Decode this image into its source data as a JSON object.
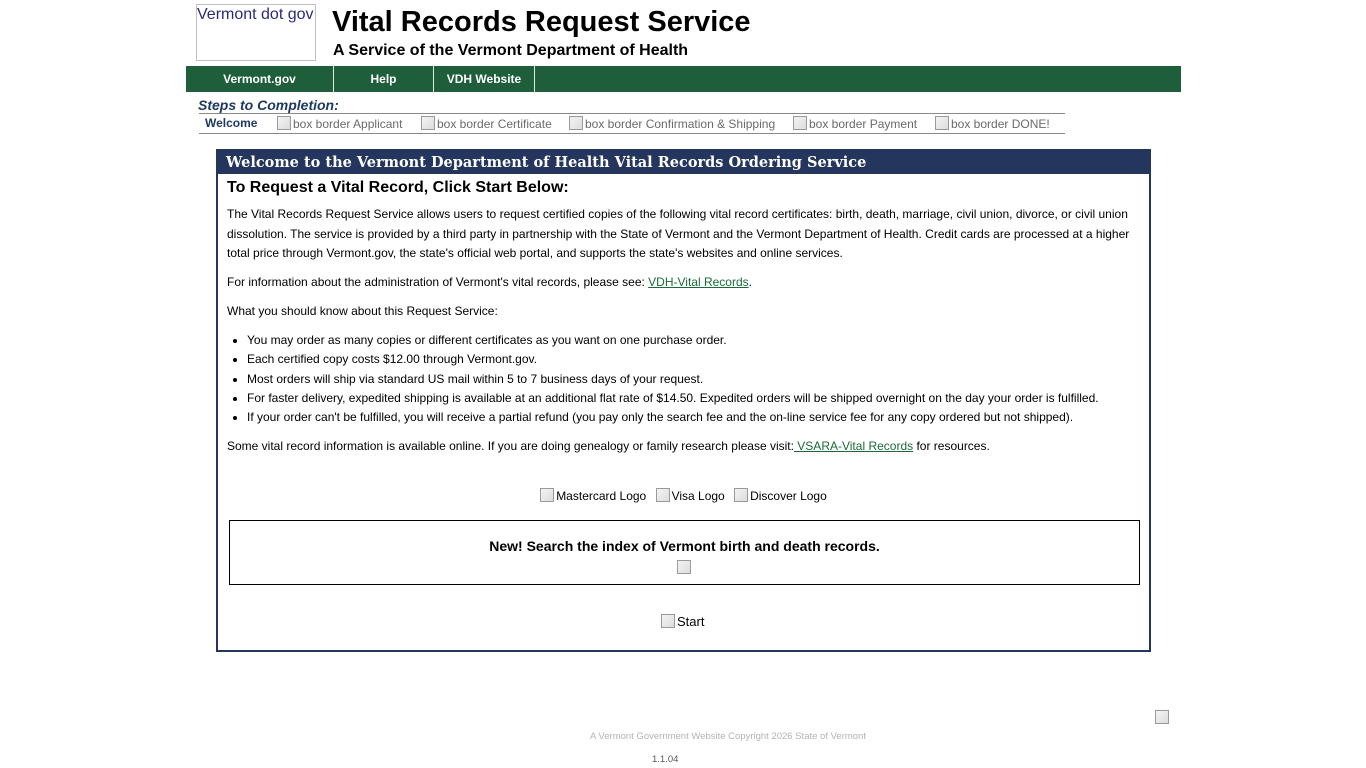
{
  "header": {
    "logo_alt": "Vermont dot gov",
    "title": "Vital Records Request Service",
    "subtitle": "A Service of the Vermont Department of Health"
  },
  "nav": {
    "items": [
      {
        "label": "Vermont.gov"
      },
      {
        "label": "Help"
      },
      {
        "label": "VDH Website"
      }
    ]
  },
  "steps": {
    "title": "Steps to Completion:",
    "image_alt": "box border",
    "items": [
      {
        "label": "Welcome",
        "active": true
      },
      {
        "label": "Applicant"
      },
      {
        "label": "Certificate"
      },
      {
        "label": "Confirmation & Shipping"
      },
      {
        "label": "Payment"
      },
      {
        "label": "DONE!"
      }
    ]
  },
  "panel": {
    "header": "Welcome to the Vermont Department of Health Vital Records Ordering Service",
    "heading": "To Request a Vital Record, Click Start Below:",
    "intro": "The Vital Records Request Service allows users to request certified copies of the following vital record certificates: birth, death, marriage, civil union, divorce, or civil union dissolution. The service is provided by a third party in partnership with the State of Vermont and the Vermont Department of Health. Credit cards are processed at a higher total price through Vermont.gov, the state's official web portal, and supports the state's websites and online services.",
    "admin_info_prefix": "For information about the administration of Vermont's vital records, please see: ",
    "admin_link": "VDH-Vital Records",
    "admin_info_suffix": ".",
    "know_heading": "What you should know about this Request Service:",
    "bullets": [
      "You may order as many copies or different certificates as you want on one purchase order.",
      "Each certified copy costs $12.00 through Vermont.gov.",
      "Most orders will ship via standard US mail within 5 to 7 business days of your request.",
      "For faster delivery, expedited shipping is available at an additional flat rate of $14.50. Expedited orders will be shipped overnight on the day your order is fulfilled.",
      "If your order can't be fulfilled, you will receive a partial refund (you pay only the search fee and the on-line service fee for any copy ordered but not shipped)."
    ],
    "genealogy_prefix": "Some vital record information is available online. If you are doing genealogy or family research please visit:",
    "genealogy_link": " VSARA-Vital Records",
    "genealogy_suffix": " for resources.",
    "card_logos": [
      "Mastercard Logo",
      "Visa Logo",
      "Discover Logo"
    ],
    "search_notice": "New! Search the index of Vermont birth and death records.",
    "start_label": "Start"
  },
  "footer": {
    "text": "A Vermont Government Website   Copyright 2026 State of Vermont",
    "version": "1.1.04"
  }
}
